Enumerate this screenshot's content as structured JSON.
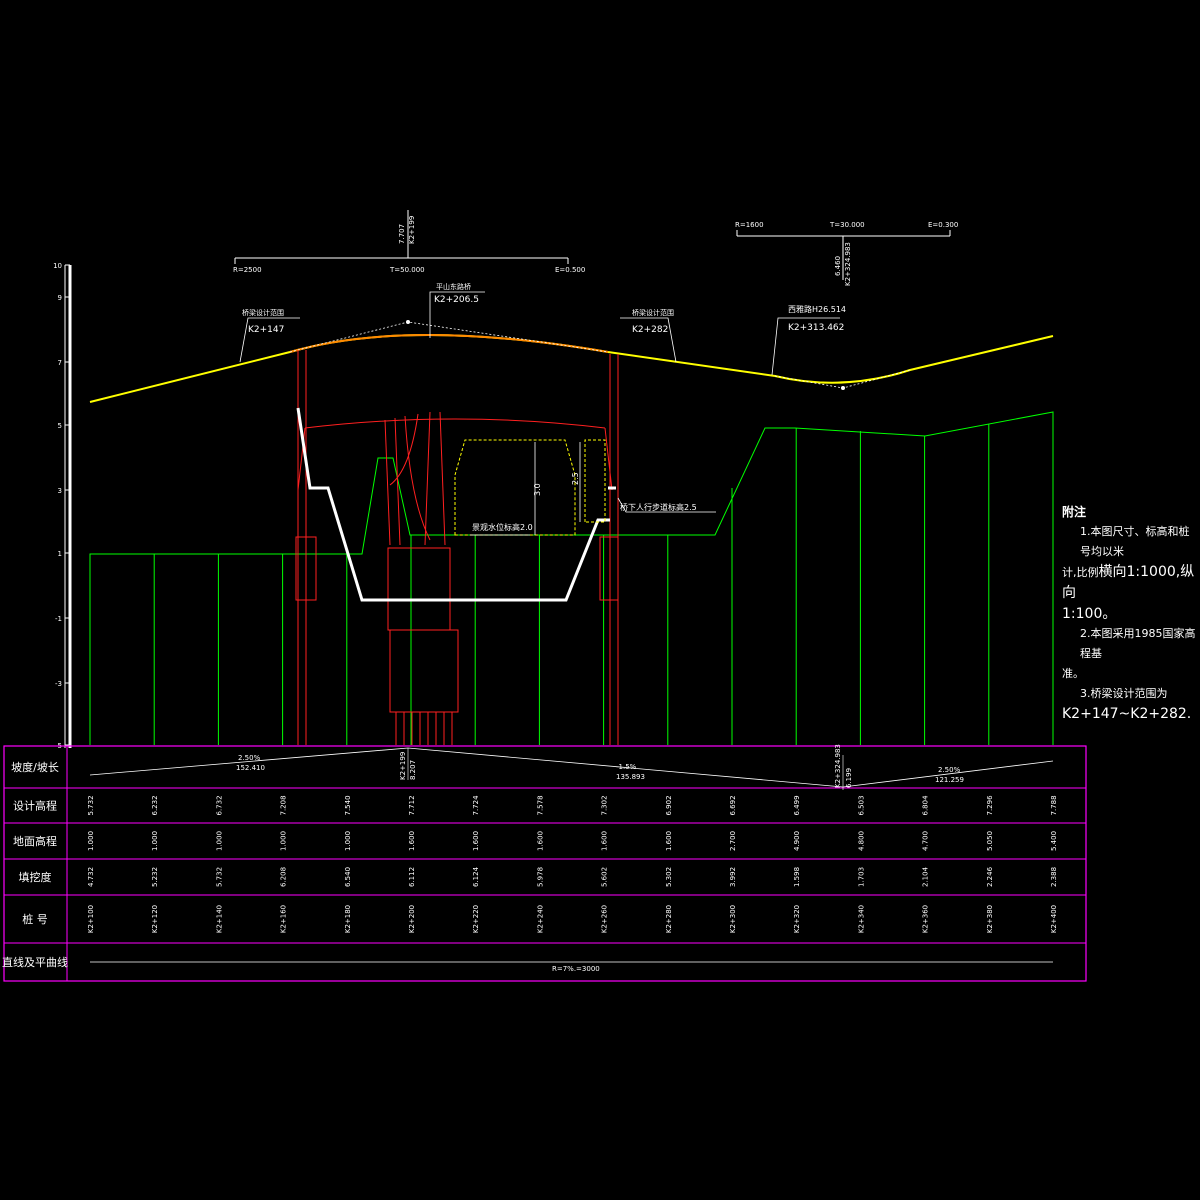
{
  "colors": {
    "background": "#000000",
    "ground": "#00ff00",
    "design_line": "#ffff00",
    "bridge": "#ff2020",
    "table_frame": "#ff00ff",
    "text": "#ffffff",
    "channel": "#ffffff"
  },
  "elevation_axis": {
    "ticks": [
      "10",
      "9",
      "7",
      "5",
      "3",
      "1",
      "-1",
      "-3",
      "-5"
    ]
  },
  "vertical_curves": [
    {
      "R": "R=2500",
      "T": "T=50.000",
      "E": "E=0.500",
      "top1": "7.707",
      "top2": "K2+199"
    },
    {
      "R": "R=1600",
      "T": "T=30.000",
      "E": "E=0.300",
      "top1": "6.460",
      "top2": "K2+324.983"
    }
  ],
  "callouts": {
    "bridge_start_label": "桥梁设计范围",
    "bridge_start_station": "K2+147",
    "bridge_center_label": "平山东路桥",
    "bridge_center_station": "K2+206.5",
    "bridge_end_label": "桥梁设计范围",
    "bridge_end_station": "K2+282",
    "junction_label": "西雅路H26.514",
    "junction_station": "K2+313.462",
    "dim_3": "3.0",
    "dim_25": "2.5",
    "water_level": "景观水位标高2.0",
    "walkway": "桥下人行步道标高2.5"
  },
  "table": {
    "row_labels": [
      "坡度/坡长",
      "设计高程",
      "地面高程",
      "填挖度",
      "桩  号",
      "直线及平曲线"
    ],
    "grade_segments": [
      {
        "pct": "2.50%",
        "len": "152.410"
      },
      {
        "pct": "-1.5%",
        "len": "135.893"
      },
      {
        "pct": "2.50%",
        "len": "121.259"
      }
    ],
    "grade_points": [
      {
        "a": "K2+199",
        "b": "8.207"
      },
      {
        "a": "K2+324.983",
        "b": "6.199"
      }
    ],
    "design_elev": [
      "5.732",
      "6.232",
      "6.732",
      "7.208",
      "7.540",
      "7.712",
      "7.724",
      "7.578",
      "7.302",
      "6.902",
      "6.692",
      "6.499",
      "6.503",
      "6.804",
      "7.296",
      "7.788"
    ],
    "ground_elev": [
      "1.000",
      "1.000",
      "1.000",
      "1.000",
      "1.000",
      "1.600",
      "1.600",
      "1.600",
      "1.600",
      "1.600",
      "2.700",
      "4.900",
      "4.800",
      "4.700",
      "5.050",
      "5.400"
    ],
    "fill_cut": [
      "4.732",
      "5.232",
      "5.732",
      "6.208",
      "6.540",
      "6.112",
      "6.124",
      "5.978",
      "5.602",
      "5.302",
      "3.992",
      "1.598",
      "1.703",
      "2.104",
      "2.246",
      "2.388"
    ],
    "stations": [
      "K2+100",
      "K2+120",
      "K2+140",
      "K2+160",
      "K2+180",
      "K2+200",
      "K2+220",
      "K2+240",
      "K2+260",
      "K2+280",
      "K2+300",
      "K2+320",
      "K2+340",
      "K2+360",
      "K2+380",
      "K2+400"
    ],
    "curve_label": "R=7%.=3000"
  },
  "notes": {
    "title": "附注",
    "l1": "1.本图尺寸、标高和桩号均以米",
    "l2a": "计,比例",
    "l2b": "横向1:1000,纵向",
    "l3": "1:100。",
    "l4": "2.本图采用1985国家高程基",
    "l5": "准。",
    "l6": "3.桥梁设计范围为",
    "l7": "K2+147~K2+282."
  }
}
